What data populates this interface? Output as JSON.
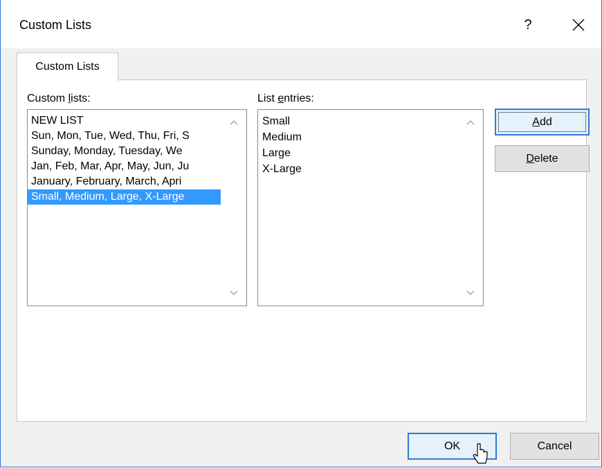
{
  "window": {
    "title": "Custom Lists",
    "help_label": "?",
    "close_label": "✕"
  },
  "tab": {
    "label": "Custom Lists"
  },
  "custom_lists": {
    "label_prefix": "Custom ",
    "label_accel": "l",
    "label_suffix": "ists:",
    "items": [
      "NEW LIST",
      "Sun, Mon, Tue, Wed, Thu, Fri, S",
      "Sunday, Monday, Tuesday, We",
      "Jan, Feb, Mar, Apr, May, Jun, Ju",
      "January, February, March, Apri",
      "Small, Medium, Large, X-Large"
    ],
    "selected_index": 5
  },
  "list_entries": {
    "label_prefix": "List ",
    "label_accel": "e",
    "label_suffix": "ntries:",
    "items": [
      "Small",
      "Medium",
      "Large",
      "X-Large"
    ]
  },
  "buttons": {
    "add_accel": "A",
    "add_rest": "dd",
    "delete_accel": "D",
    "delete_rest": "elete",
    "ok": "OK",
    "cancel": "Cancel"
  },
  "colors": {
    "accent": "#2b78d4",
    "selection": "#3399ff"
  }
}
